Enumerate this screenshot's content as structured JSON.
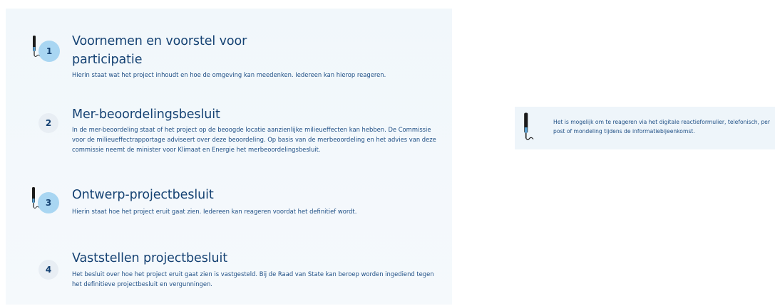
{
  "steps": [
    {
      "number": "1",
      "title_line1": "Voornemen en voorstel voor",
      "title_line2": "participatie",
      "description": "Hierin staat wat het project inhoudt en hoe de omgeving kan meedenken. Iedereen kan hierop reageren.",
      "can_respond": true
    },
    {
      "number": "2",
      "title": "Mer-beoordelingsbesluit",
      "description": "In de mer-beoordeling staat of het project op de beoogde locatie aanzienlijke milieueffecten kan hebben. De Commissie voor de milieueffectrapportage adviseert over deze beoordeling. Op basis van de merbeoordeling en het advies van deze commissie neemt de minister voor Klimaat en Energie het merbeoordelingsbesluit.",
      "can_respond": false
    },
    {
      "number": "3",
      "title": "Ontwerp-projectbesluit",
      "description": "Hierin staat hoe het project eruit gaat zien. Iedereen kan reageren voordat het definitief wordt.",
      "can_respond": true
    },
    {
      "number": "4",
      "title": "Vaststellen projectbesluit",
      "description": "Het besluit over hoe het project eruit gaat zien is vastgesteld. Bij de Raad van State kan beroep worden ingediend tegen het definitieve projectbesluit en vergunningen.",
      "can_respond": false
    }
  ],
  "legend": {
    "text": "Het is mogelijk om te reageren via het digitale reactieformulier, telefonisch, per post of mondeling tijdens de informatiebijeenkomst.",
    "icon": "pen-icon"
  },
  "colors": {
    "primary": "#154273",
    "active_badge": "#a9d6f2",
    "inactive_badge": "#e8eef4",
    "panel_bg": "#f1f7fb",
    "pen_dark": "#1a1a1a",
    "pen_tip": "#5aa0d0"
  }
}
